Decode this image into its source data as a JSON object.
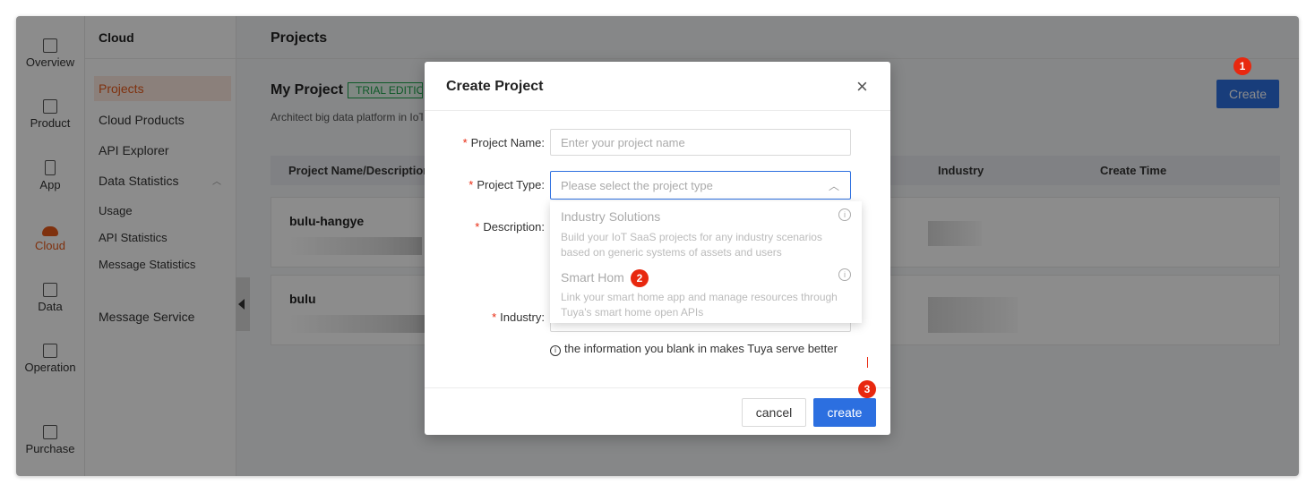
{
  "rail": {
    "items": [
      {
        "label": "Overview"
      },
      {
        "label": "Product"
      },
      {
        "label": "App"
      },
      {
        "label": "Cloud"
      },
      {
        "label": "Data"
      },
      {
        "label": "Operation"
      },
      {
        "label": "Purchase"
      }
    ]
  },
  "submenu": {
    "heading": "Cloud",
    "items": {
      "projects": "Projects",
      "cloud_products": "Cloud Products",
      "api_explorer": "API Explorer",
      "data_statistics": "Data Statistics",
      "usage": "Usage",
      "api_statistics": "API Statistics",
      "message_statistics": "Message Statistics",
      "message_service": "Message Service"
    }
  },
  "main": {
    "title": "Projects",
    "section_title": "My Project",
    "edition_tag": "TRIAL EDITIO",
    "description": "Architect big data platform in IoT",
    "create_button": "Create",
    "table": {
      "headers": [
        "Project Name/Description",
        "Industry",
        "Create Time"
      ],
      "rows": [
        {
          "name": "bulu-hangye"
        },
        {
          "name": "bulu"
        }
      ]
    }
  },
  "badges": {
    "one": "1",
    "two": "2",
    "three": "3"
  },
  "modal": {
    "title": "Create Project",
    "close_glyph": "×",
    "fields": {
      "project_name": {
        "label": "Project Name",
        "placeholder": "Enter your project name"
      },
      "project_type": {
        "label": "Project Type",
        "placeholder": "Please select the project type"
      },
      "description": {
        "label": "Description"
      },
      "industry": {
        "label": "Industry"
      }
    },
    "type_options": [
      {
        "title": "Industry Solutions",
        "desc": "Build your IoT SaaS projects for any industry scenarios based on generic systems of assets and users"
      },
      {
        "title": "Smart Hom",
        "desc": "Link your smart home app and manage resources through Tuya's smart home open APIs"
      }
    ],
    "hint": "the information you blank in makes Tuya serve better",
    "cancel": "cancel",
    "create": "create"
  },
  "colors": {
    "accent": "#2c6fe0",
    "brand": "#e85a1b",
    "badge": "#e8280f"
  }
}
